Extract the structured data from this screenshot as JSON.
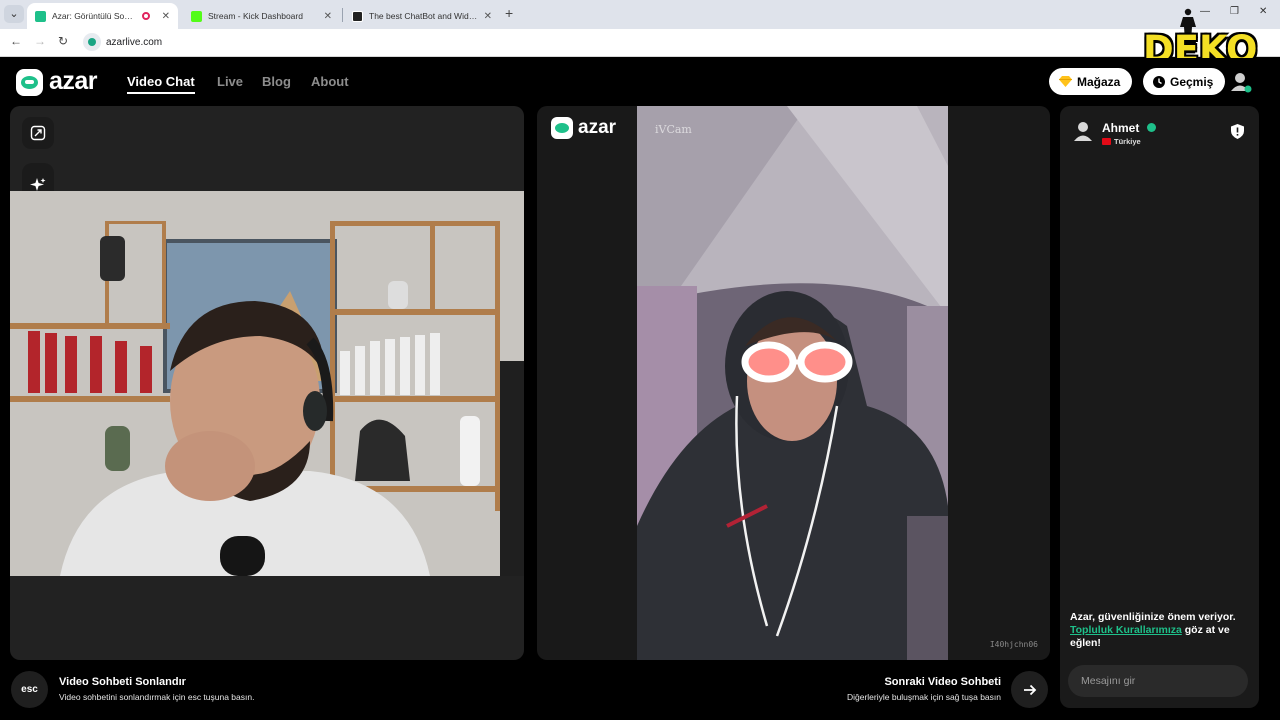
{
  "browser": {
    "tabs": [
      {
        "title": "Azar: Görüntülü Sohbet, Ara",
        "favicon_color": "#1ec08a",
        "active": true
      },
      {
        "title": "Stream - Kick Dashboard",
        "favicon_color": "#53fc18",
        "active": false
      },
      {
        "title": "The best ChatBot and Widgets",
        "favicon_color": "#222222",
        "active": false
      }
    ],
    "url": "azarlive.com"
  },
  "overlay": {
    "watermark": "DEKO"
  },
  "header": {
    "logo": "azar",
    "nav": [
      {
        "label": "Video Chat",
        "active": true
      },
      {
        "label": "Live",
        "active": false
      },
      {
        "label": "Blog",
        "active": false
      },
      {
        "label": "About",
        "active": false
      }
    ],
    "shop_label": "Mağaza",
    "history_label": "Geçmiş"
  },
  "video": {
    "partner_brand": "azar",
    "partner_cam_label": "iVCam",
    "partner_watermark": "I40hjchn06"
  },
  "chat": {
    "partner_name": "Ahmet",
    "partner_country": "Türkiye",
    "safety_prefix": "Azar, güvenliğinize önem veriyor.",
    "safety_link": "Topluluk Kurallarımıza",
    "safety_suffix": "göz at ve eğlen!",
    "input_placeholder": "Mesajını gir"
  },
  "bottom": {
    "esc_key": "esc",
    "end_title": "Video Sohbeti Sonlandır",
    "end_sub": "Video sohbetini sonlandırmak için esc tuşuna basın.",
    "next_title": "Sonraki Video Sohbeti",
    "next_sub": "Diğerleriyle buluşmak için sağ tuşa basın"
  },
  "colors": {
    "accent": "#1ec08a",
    "panel": "#222222",
    "background": "#000000"
  }
}
